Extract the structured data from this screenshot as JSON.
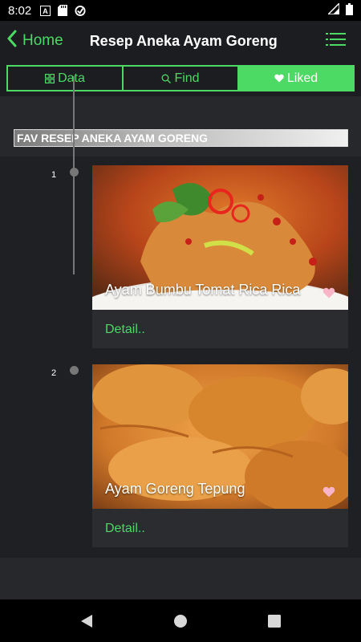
{
  "status_bar": {
    "time": "8:02",
    "icons": [
      "a-notification-icon",
      "sd-card-icon",
      "sync-icon"
    ],
    "right_icons": [
      "signal-icon",
      "battery-icon"
    ]
  },
  "app_bar": {
    "back_label": "Home",
    "title": "Resep Aneka Ayam Goreng",
    "menu_icon": "menu-icon"
  },
  "tabs": [
    {
      "label": "Data",
      "icon": "grid-icon",
      "active": false
    },
    {
      "label": "Find",
      "icon": "search-icon",
      "active": false
    },
    {
      "label": "Liked",
      "icon": "heart-icon",
      "active": true
    }
  ],
  "section_title": "FAV RESEP ANEKA AYAM GORENG",
  "items": [
    {
      "number": "1",
      "name": "Ayam Bumbu Tomat Rica Rica",
      "detail": "Detail..",
      "liked": true
    },
    {
      "number": "2",
      "name": "Ayam Goreng Tepung",
      "detail": "Detail..",
      "liked": true
    }
  ],
  "colors": {
    "accent": "#4cd964",
    "background": "#26282c",
    "bar": "#1c1d20",
    "heart": "#f8b4c8"
  },
  "nav_bar": [
    "back-triangle-icon",
    "home-circle-icon",
    "recents-square-icon"
  ]
}
